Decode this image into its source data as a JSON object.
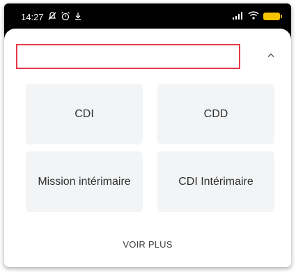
{
  "status_bar": {
    "time": "14:27",
    "icons": [
      "muted-notification-icon",
      "alarm-icon",
      "download-icon",
      "signal-icon",
      "wifi-icon",
      "battery-icon"
    ]
  },
  "filter": {
    "search_value": "",
    "collapse_icon": "chevron-up-icon"
  },
  "contract_types": [
    "CDI",
    "CDD",
    "Mission intérimaire",
    "CDI Intérimaire"
  ],
  "more_label": "VOIR PLUS",
  "colors": {
    "highlight_border": "#e63946",
    "card_bg": "#f2f4f6",
    "battery": "#f6c400"
  }
}
